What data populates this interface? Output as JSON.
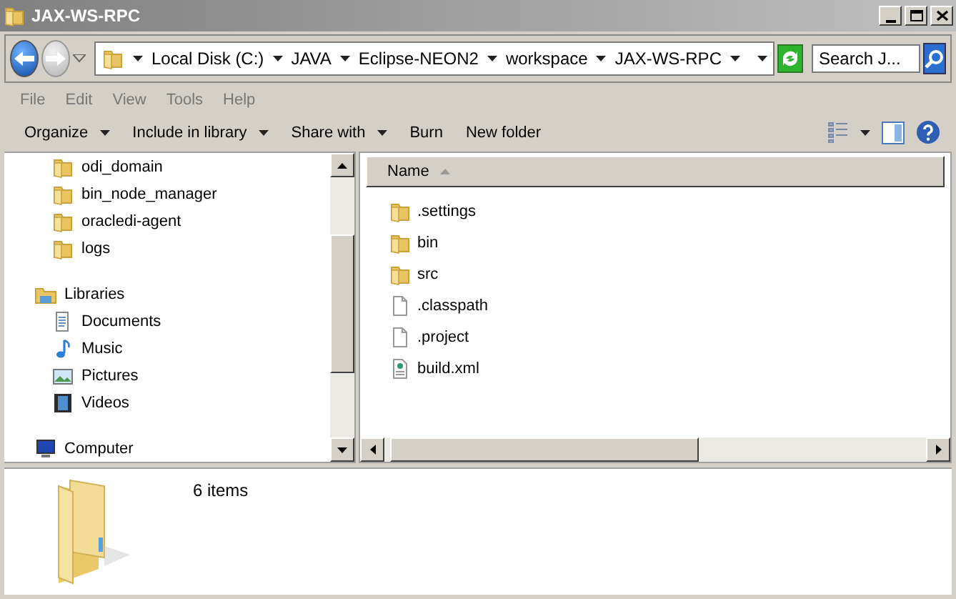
{
  "window": {
    "title": "JAX-WS-RPC"
  },
  "address": {
    "segments": [
      "Local Disk (C:)",
      "JAVA",
      "Eclipse-NEON2",
      "workspace",
      "JAX-WS-RPC"
    ]
  },
  "search": {
    "placeholder": "Search J..."
  },
  "menu": [
    "File",
    "Edit",
    "View",
    "Tools",
    "Help"
  ],
  "toolbar": [
    {
      "label": "Organize",
      "dropdown": true
    },
    {
      "label": "Include in library",
      "dropdown": true
    },
    {
      "label": "Share with",
      "dropdown": true
    },
    {
      "label": "Burn",
      "dropdown": false
    },
    {
      "label": "New folder",
      "dropdown": false
    }
  ],
  "nav_tree": [
    {
      "kind": "group",
      "children": [
        {
          "label": "odi_domain",
          "kind": "folder"
        },
        {
          "label": "bin_node_manager",
          "kind": "folder"
        },
        {
          "label": "oracledi-agent",
          "kind": "folder"
        },
        {
          "label": "logs",
          "kind": "folder"
        }
      ]
    },
    {
      "label": "Libraries",
      "kind": "library",
      "children": [
        {
          "label": "Documents",
          "kind": "documents"
        },
        {
          "label": "Music",
          "kind": "music"
        },
        {
          "label": "Pictures",
          "kind": "pictures"
        },
        {
          "label": "Videos",
          "kind": "videos"
        }
      ]
    },
    {
      "label": "Computer",
      "kind": "computer"
    }
  ],
  "file_list": {
    "columns": [
      "Name"
    ],
    "items": [
      {
        "name": ".settings",
        "kind": "folder"
      },
      {
        "name": "bin",
        "kind": "folder"
      },
      {
        "name": "src",
        "kind": "folder"
      },
      {
        "name": ".classpath",
        "kind": "file"
      },
      {
        "name": ".project",
        "kind": "file"
      },
      {
        "name": "build.xml",
        "kind": "xml"
      }
    ]
  },
  "details": {
    "count": "6 items"
  }
}
